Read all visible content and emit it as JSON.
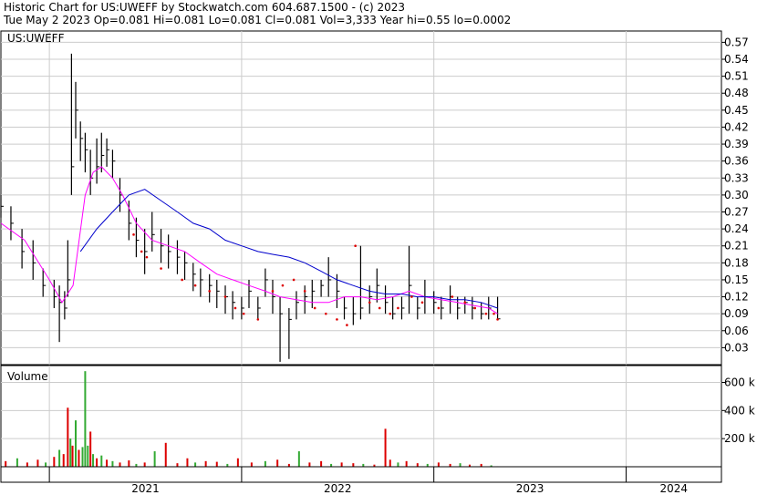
{
  "header": {
    "title": "Historic Chart for US:UWEFF by Stockwatch.com 604.687.1500 - (c) 2023",
    "quote": "Tue May  2 2023  Op=0.081  Hi=0.081  Lo=0.081  Cl=0.081  Vol=3,333  Year hi=0.55  lo=0.0002"
  },
  "colors": {
    "background": "#ffffff",
    "grid": "#cccccc",
    "frame": "#000000",
    "price": "#000000",
    "ma_short": "#ff00ff",
    "ma_long": "#0000cc",
    "dots": "#dd0000",
    "vol_up": "#33aa33",
    "vol_down": "#dd0000"
  },
  "chart_data": [
    {
      "type": "line",
      "panel_label": "US:UWEFF",
      "y_ticks": [
        "0.03",
        "0.06",
        "0.09",
        "0.12",
        "0.15",
        "0.18",
        "0.21",
        "0.24",
        "0.27",
        "0.30",
        "0.33",
        "0.36",
        "0.39",
        "0.42",
        "0.45",
        "0.48",
        "0.51",
        "0.54",
        "0.57"
      ],
      "ylim": [
        0.0,
        0.59
      ],
      "x_ticks": [
        "2021",
        "2022",
        "2023",
        "2024"
      ],
      "xlim": [
        "2020-10-01",
        "2024-06-30"
      ],
      "grid": true,
      "series": [
        {
          "style": "price",
          "x": [
            "2020-10-01",
            "2020-10-20",
            "2020-11-10",
            "2020-12-01",
            "2020-12-20",
            "2021-01-10",
            "2021-01-20",
            "2021-01-30",
            "2021-02-05",
            "2021-02-12",
            "2021-02-20",
            "2021-03-01",
            "2021-03-10",
            "2021-03-20",
            "2021-04-01",
            "2021-04-10",
            "2021-04-20",
            "2021-05-01",
            "2021-05-15",
            "2021-06-01",
            "2021-06-15",
            "2021-07-01",
            "2021-07-15",
            "2021-08-01",
            "2021-08-15",
            "2021-09-01",
            "2021-09-15",
            "2021-10-01",
            "2021-10-15",
            "2021-11-01",
            "2021-11-15",
            "2021-12-01",
            "2021-12-15",
            "2022-01-01",
            "2022-01-15",
            "2022-02-01",
            "2022-02-15",
            "2022-03-01",
            "2022-03-15",
            "2022-04-01",
            "2022-04-15",
            "2022-05-01",
            "2022-05-15",
            "2022-06-01",
            "2022-06-15",
            "2022-07-01",
            "2022-07-15",
            "2022-08-01",
            "2022-08-15",
            "2022-09-01",
            "2022-09-15",
            "2022-10-01",
            "2022-10-15",
            "2022-11-01",
            "2022-11-15",
            "2022-12-01",
            "2022-12-15",
            "2023-01-01",
            "2023-01-15",
            "2023-02-01",
            "2023-02-15",
            "2023-03-01",
            "2023-03-15",
            "2023-04-01",
            "2023-04-15",
            "2023-05-02"
          ],
          "values": [
            0.28,
            0.25,
            0.2,
            0.18,
            0.14,
            0.12,
            0.11,
            0.1,
            0.15,
            0.35,
            0.45,
            0.4,
            0.38,
            0.33,
            0.35,
            0.37,
            0.38,
            0.36,
            0.3,
            0.25,
            0.22,
            0.2,
            0.23,
            0.21,
            0.2,
            0.19,
            0.18,
            0.16,
            0.15,
            0.14,
            0.13,
            0.12,
            0.11,
            0.1,
            0.13,
            0.1,
            0.15,
            0.12,
            0.09,
            0.08,
            0.11,
            0.12,
            0.13,
            0.14,
            0.15,
            0.13,
            0.1,
            0.09,
            0.1,
            0.12,
            0.14,
            0.11,
            0.09,
            0.1,
            0.14,
            0.1,
            0.12,
            0.11,
            0.1,
            0.12,
            0.1,
            0.11,
            0.1,
            0.09,
            0.1,
            0.081
          ],
          "highs": [
            0.3,
            0.28,
            0.24,
            0.22,
            0.17,
            0.15,
            0.14,
            0.13,
            0.22,
            0.55,
            0.5,
            0.43,
            0.41,
            0.38,
            0.4,
            0.41,
            0.4,
            0.38,
            0.33,
            0.29,
            0.26,
            0.24,
            0.27,
            0.24,
            0.23,
            0.22,
            0.2,
            0.18,
            0.17,
            0.16,
            0.15,
            0.14,
            0.13,
            0.12,
            0.15,
            0.12,
            0.17,
            0.15,
            0.12,
            0.1,
            0.13,
            0.14,
            0.15,
            0.15,
            0.19,
            0.16,
            0.12,
            0.12,
            0.21,
            0.14,
            0.17,
            0.14,
            0.12,
            0.12,
            0.21,
            0.12,
            0.15,
            0.13,
            0.12,
            0.14,
            0.12,
            0.12,
            0.12,
            0.11,
            0.12,
            0.12
          ],
          "lows": [
            0.26,
            0.22,
            0.17,
            0.15,
            0.12,
            0.1,
            0.04,
            0.08,
            0.12,
            0.3,
            0.4,
            0.36,
            0.34,
            0.3,
            0.32,
            0.34,
            0.35,
            0.33,
            0.27,
            0.22,
            0.19,
            0.16,
            0.2,
            0.18,
            0.17,
            0.16,
            0.15,
            0.13,
            0.12,
            0.11,
            0.1,
            0.09,
            0.08,
            0.08,
            0.1,
            0.08,
            0.12,
            0.09,
            0.005,
            0.01,
            0.08,
            0.09,
            0.1,
            0.12,
            0.12,
            0.1,
            0.08,
            0.07,
            0.08,
            0.09,
            0.11,
            0.09,
            0.08,
            0.08,
            0.09,
            0.08,
            0.09,
            0.09,
            0.08,
            0.09,
            0.08,
            0.09,
            0.08,
            0.08,
            0.08,
            0.08
          ]
        },
        {
          "style": "ma_short",
          "x": [
            "2020-10-01",
            "2020-11-15",
            "2021-01-01",
            "2021-01-25",
            "2021-02-15",
            "2021-03-10",
            "2021-03-25",
            "2021-04-10",
            "2021-05-01",
            "2021-05-20",
            "2021-06-15",
            "2021-07-15",
            "2021-08-15",
            "2021-09-15",
            "2021-10-15",
            "2021-11-15",
            "2021-12-15",
            "2022-01-15",
            "2022-02-15",
            "2022-03-15",
            "2022-04-15",
            "2022-05-15",
            "2022-06-15",
            "2022-07-15",
            "2022-08-15",
            "2022-09-15",
            "2022-10-15",
            "2022-11-15",
            "2022-12-15",
            "2023-01-15",
            "2023-02-15",
            "2023-03-15",
            "2023-04-15",
            "2023-05-02"
          ],
          "values": [
            0.25,
            0.22,
            0.15,
            0.11,
            0.14,
            0.3,
            0.34,
            0.35,
            0.33,
            0.3,
            0.25,
            0.22,
            0.21,
            0.2,
            0.18,
            0.16,
            0.15,
            0.14,
            0.13,
            0.12,
            0.115,
            0.11,
            0.11,
            0.12,
            0.12,
            0.115,
            0.12,
            0.13,
            0.12,
            0.115,
            0.11,
            0.105,
            0.1,
            0.09
          ]
        },
        {
          "style": "ma_long",
          "x": [
            "2021-03-01",
            "2021-04-01",
            "2021-05-01",
            "2021-06-01",
            "2021-07-01",
            "2021-08-01",
            "2021-09-01",
            "2021-10-01",
            "2021-11-01",
            "2021-12-01",
            "2022-01-01",
            "2022-02-01",
            "2022-03-01",
            "2022-04-01",
            "2022-05-01",
            "2022-06-01",
            "2022-07-01",
            "2022-08-01",
            "2022-09-01",
            "2022-10-01",
            "2022-11-01",
            "2022-12-01",
            "2023-01-01",
            "2023-02-01",
            "2023-03-01",
            "2023-04-01",
            "2023-05-02"
          ],
          "values": [
            0.2,
            0.24,
            0.27,
            0.3,
            0.31,
            0.29,
            0.27,
            0.25,
            0.24,
            0.22,
            0.21,
            0.2,
            0.195,
            0.19,
            0.18,
            0.165,
            0.15,
            0.14,
            0.13,
            0.125,
            0.125,
            0.12,
            0.12,
            0.115,
            0.115,
            0.11,
            0.1
          ]
        }
      ],
      "dots": {
        "x": [
          "2021-06-10",
          "2021-06-25",
          "2021-07-05",
          "2021-08-01",
          "2021-09-10",
          "2021-10-05",
          "2021-11-01",
          "2021-12-01",
          "2021-12-20",
          "2022-01-05",
          "2022-02-01",
          "2022-03-01",
          "2022-03-20",
          "2022-04-10",
          "2022-05-01",
          "2022-05-20",
          "2022-06-10",
          "2022-07-01",
          "2022-07-20",
          "2022-08-05",
          "2022-09-01",
          "2022-09-20",
          "2022-10-10",
          "2022-10-25",
          "2022-11-20",
          "2022-12-10",
          "2023-01-10",
          "2023-02-05",
          "2023-03-01",
          "2023-03-20",
          "2023-04-10",
          "2023-04-25",
          "2023-05-02"
        ],
        "values": [
          0.23,
          0.2,
          0.19,
          0.17,
          0.15,
          0.14,
          0.13,
          0.12,
          0.1,
          0.09,
          0.08,
          0.13,
          0.14,
          0.15,
          0.13,
          0.1,
          0.09,
          0.08,
          0.07,
          0.21,
          0.11,
          0.1,
          0.09,
          0.1,
          0.12,
          0.11,
          0.1,
          0.12,
          0.11,
          0.1,
          0.09,
          0.09,
          0.08
        ]
      }
    },
    {
      "type": "bar",
      "panel_label": "Volume",
      "y_ticks": [
        "200 k",
        "400 k",
        "600 k"
      ],
      "ylim": [
        0,
        720000
      ],
      "up_color_note": "green = up day, red = down day",
      "bars": [
        {
          "x": "2020-10-10",
          "v": 40000,
          "up": false
        },
        {
          "x": "2020-11-01",
          "v": 60000,
          "up": true
        },
        {
          "x": "2020-11-20",
          "v": 30000,
          "up": false
        },
        {
          "x": "2020-12-10",
          "v": 50000,
          "up": false
        },
        {
          "x": "2020-12-25",
          "v": 30000,
          "up": true
        },
        {
          "x": "2021-01-10",
          "v": 70000,
          "up": false
        },
        {
          "x": "2021-01-20",
          "v": 120000,
          "up": true
        },
        {
          "x": "2021-01-28",
          "v": 90000,
          "up": false
        },
        {
          "x": "2021-02-05",
          "v": 420000,
          "up": false
        },
        {
          "x": "2021-02-10",
          "v": 200000,
          "up": true
        },
        {
          "x": "2021-02-14",
          "v": 150000,
          "up": false
        },
        {
          "x": "2021-02-20",
          "v": 330000,
          "up": true
        },
        {
          "x": "2021-02-26",
          "v": 120000,
          "up": false
        },
        {
          "x": "2021-03-05",
          "v": 140000,
          "up": true
        },
        {
          "x": "2021-03-10",
          "v": 680000,
          "up": true
        },
        {
          "x": "2021-03-15",
          "v": 150000,
          "up": true
        },
        {
          "x": "2021-03-20",
          "v": 250000,
          "up": false
        },
        {
          "x": "2021-03-25",
          "v": 90000,
          "up": true
        },
        {
          "x": "2021-04-01",
          "v": 60000,
          "up": false
        },
        {
          "x": "2021-04-10",
          "v": 80000,
          "up": true
        },
        {
          "x": "2021-04-20",
          "v": 50000,
          "up": false
        },
        {
          "x": "2021-05-01",
          "v": 40000,
          "up": true
        },
        {
          "x": "2021-05-15",
          "v": 30000,
          "up": false
        },
        {
          "x": "2021-06-01",
          "v": 45000,
          "up": false
        },
        {
          "x": "2021-06-15",
          "v": 20000,
          "up": true
        },
        {
          "x": "2021-07-01",
          "v": 30000,
          "up": false
        },
        {
          "x": "2021-07-20",
          "v": 110000,
          "up": true
        },
        {
          "x": "2021-08-10",
          "v": 170000,
          "up": false
        },
        {
          "x": "2021-09-01",
          "v": 25000,
          "up": false
        },
        {
          "x": "2021-09-20",
          "v": 60000,
          "up": false
        },
        {
          "x": "2021-10-05",
          "v": 30000,
          "up": true
        },
        {
          "x": "2021-10-25",
          "v": 40000,
          "up": false
        },
        {
          "x": "2021-11-15",
          "v": 35000,
          "up": false
        },
        {
          "x": "2021-12-05",
          "v": 20000,
          "up": true
        },
        {
          "x": "2021-12-25",
          "v": 60000,
          "up": false
        },
        {
          "x": "2022-01-20",
          "v": 30000,
          "up": false
        },
        {
          "x": "2022-02-15",
          "v": 40000,
          "up": true
        },
        {
          "x": "2022-03-10",
          "v": 50000,
          "up": false
        },
        {
          "x": "2022-04-01",
          "v": 20000,
          "up": false
        },
        {
          "x": "2022-04-20",
          "v": 110000,
          "up": true
        },
        {
          "x": "2022-05-10",
          "v": 30000,
          "up": false
        },
        {
          "x": "2022-06-01",
          "v": 40000,
          "up": false
        },
        {
          "x": "2022-06-20",
          "v": 20000,
          "up": true
        },
        {
          "x": "2022-07-10",
          "v": 30000,
          "up": false
        },
        {
          "x": "2022-08-01",
          "v": 25000,
          "up": false
        },
        {
          "x": "2022-08-20",
          "v": 20000,
          "up": true
        },
        {
          "x": "2022-09-10",
          "v": 15000,
          "up": false
        },
        {
          "x": "2022-10-01",
          "v": 270000,
          "up": false
        },
        {
          "x": "2022-10-10",
          "v": 50000,
          "up": false
        },
        {
          "x": "2022-10-25",
          "v": 30000,
          "up": true
        },
        {
          "x": "2022-11-10",
          "v": 40000,
          "up": false
        },
        {
          "x": "2022-12-01",
          "v": 25000,
          "up": false
        },
        {
          "x": "2022-12-20",
          "v": 20000,
          "up": true
        },
        {
          "x": "2023-01-10",
          "v": 30000,
          "up": false
        },
        {
          "x": "2023-02-01",
          "v": 20000,
          "up": false
        },
        {
          "x": "2023-02-20",
          "v": 25000,
          "up": true
        },
        {
          "x": "2023-03-10",
          "v": 15000,
          "up": false
        },
        {
          "x": "2023-04-01",
          "v": 20000,
          "up": false
        },
        {
          "x": "2023-04-20",
          "v": 10000,
          "up": true
        },
        {
          "x": "2023-05-02",
          "v": 3333,
          "up": false
        }
      ]
    }
  ]
}
